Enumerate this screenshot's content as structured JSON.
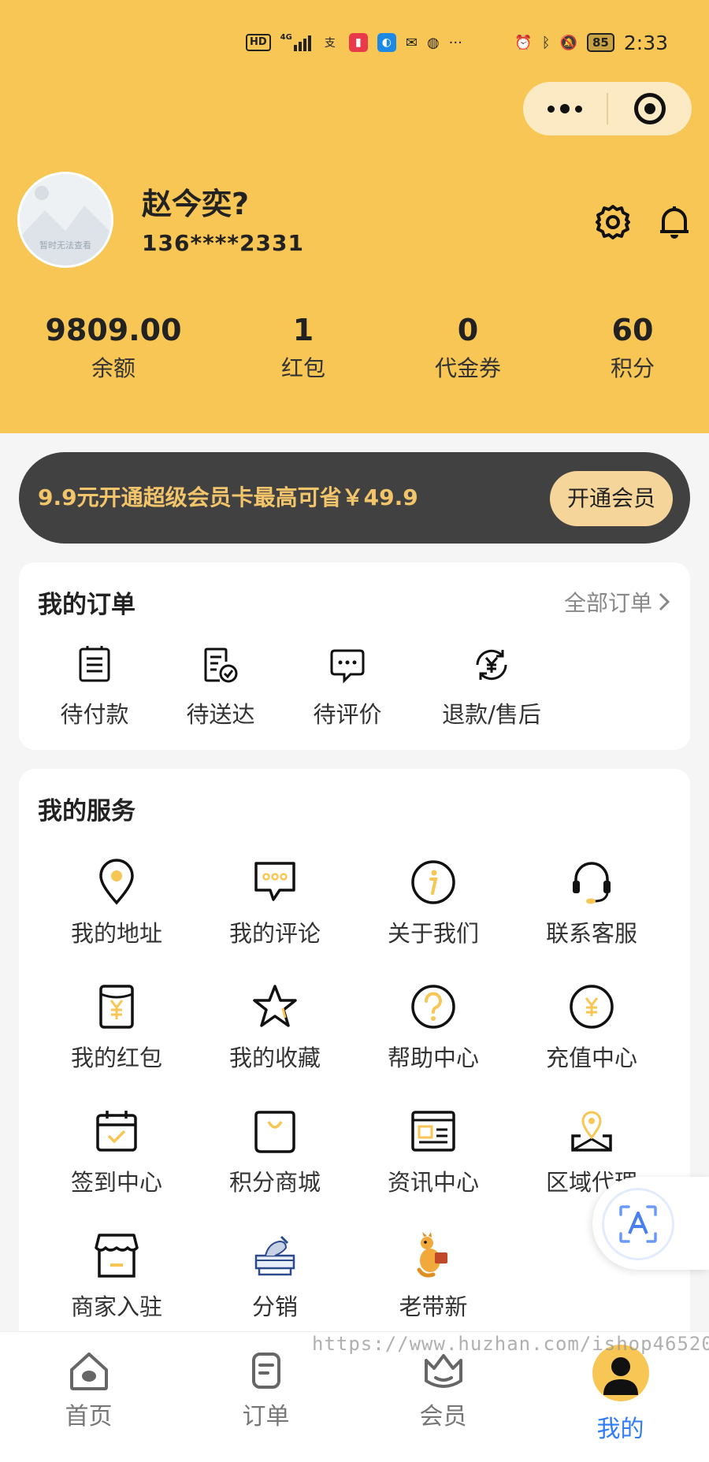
{
  "status_bar": {
    "network_badge": "HD",
    "signal": "4G",
    "battery": "85",
    "time": "2:33"
  },
  "profile": {
    "avatar_placeholder": "暂时无法查看",
    "name": "赵今奕?",
    "phone": "136****2331"
  },
  "stats": [
    {
      "value": "9809.00",
      "label": "余额"
    },
    {
      "value": "1",
      "label": "红包"
    },
    {
      "value": "0",
      "label": "代金券"
    },
    {
      "value": "60",
      "label": "积分"
    }
  ],
  "vip_banner": {
    "text": "9.9元开通超级会员卡最高可省￥49.9",
    "button": "开通会员"
  },
  "orders": {
    "title": "我的订单",
    "all_link": "全部订单",
    "items": [
      {
        "label": "待付款",
        "icon": "receipt-icon"
      },
      {
        "label": "待送达",
        "icon": "delivery-check-icon"
      },
      {
        "label": "待评价",
        "icon": "comment-icon"
      },
      {
        "label": "退款/售后",
        "icon": "refund-icon"
      }
    ]
  },
  "services": {
    "title": "我的服务",
    "items": [
      {
        "label": "我的地址",
        "icon": "location-icon"
      },
      {
        "label": "我的评论",
        "icon": "chat-icon"
      },
      {
        "label": "关于我们",
        "icon": "info-icon"
      },
      {
        "label": "联系客服",
        "icon": "headset-icon"
      },
      {
        "label": "我的红包",
        "icon": "red-packet-icon"
      },
      {
        "label": "我的收藏",
        "icon": "star-icon"
      },
      {
        "label": "帮助中心",
        "icon": "help-icon"
      },
      {
        "label": "充值中心",
        "icon": "yuan-coin-icon"
      },
      {
        "label": "签到中心",
        "icon": "calendar-check-icon"
      },
      {
        "label": "积分商城",
        "icon": "shopping-bag-icon"
      },
      {
        "label": "资讯中心",
        "icon": "news-icon"
      },
      {
        "label": "区域代理",
        "icon": "map-pin-icon"
      },
      {
        "label": "商家入驻",
        "icon": "store-icon"
      },
      {
        "label": "分销",
        "icon": "cake-icon"
      },
      {
        "label": "老带新",
        "icon": "kangaroo-icon"
      }
    ]
  },
  "tabbar": {
    "tabs": [
      {
        "label": "首页"
      },
      {
        "label": "订单"
      },
      {
        "label": "会员"
      },
      {
        "label": "我的"
      }
    ],
    "active": "我的"
  },
  "watermark": "https://www.huzhan.com/ishop46520",
  "colors": {
    "brand_yellow": "#f8c654",
    "vip_dark": "#414141",
    "vip_gold": "#f3c56b",
    "active_blue": "#2f7cf6"
  }
}
